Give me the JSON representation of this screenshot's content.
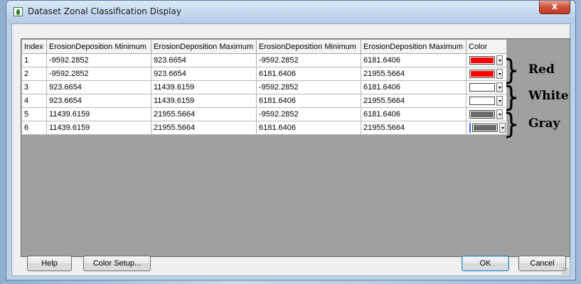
{
  "window": {
    "title": "Dataset Zonal Classification Display",
    "close_glyph": "x"
  },
  "table": {
    "columns": [
      "Index",
      "ErosionDeposition Minimum",
      "ErosionDeposition Maximum",
      "ErosionDeposition Minimum",
      "ErosionDeposition Maximum",
      "Color"
    ],
    "rows": [
      {
        "index": "1",
        "c1": "-9592.2852",
        "c2": "923.6654",
        "c3": "-9592.2852",
        "c4": "6181.6406",
        "color": "#ff0000"
      },
      {
        "index": "2",
        "c1": "-9592.2852",
        "c2": "923.6654",
        "c3": "6181.6406",
        "c4": "21955.5664",
        "color": "#ff0000"
      },
      {
        "index": "3",
        "c1": "923.6654",
        "c2": "11439.6159",
        "c3": "-9592.2852",
        "c4": "6181.6406",
        "color": "#ffffff"
      },
      {
        "index": "4",
        "c1": "923.6654",
        "c2": "11439.6159",
        "c3": "6181.6406",
        "c4": "21955.5664",
        "color": "#ffffff"
      },
      {
        "index": "5",
        "c1": "11439.6159",
        "c2": "21955.5664",
        "c3": "-9592.2852",
        "c4": "6181.6406",
        "color": "#6b6b6b"
      },
      {
        "index": "6",
        "c1": "11439.6159",
        "c2": "21955.5664",
        "c3": "6181.6406",
        "c4": "21955.5664",
        "color": "#6b6b6b"
      }
    ]
  },
  "annotations": {
    "red": "Red",
    "white": "White",
    "gray": "Gray"
  },
  "buttons": {
    "help": "Help",
    "color_setup": "Color Setup...",
    "ok": "OK",
    "cancel": "Cancel"
  }
}
